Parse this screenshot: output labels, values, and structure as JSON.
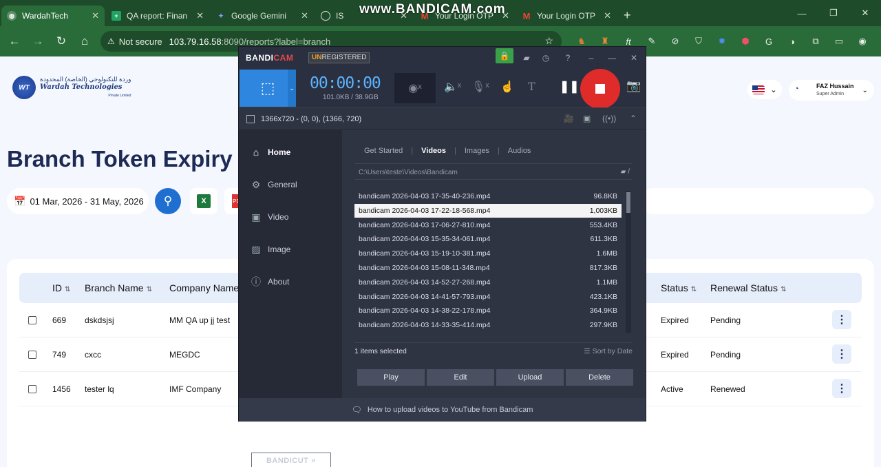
{
  "browser": {
    "tabs": [
      {
        "title": "WardahTech",
        "icon": "globe-icon",
        "active": true
      },
      {
        "title": "QA report: Finan",
        "icon": "sheets-icon",
        "active": false
      },
      {
        "title": "Google Gemini",
        "icon": "gemini-icon",
        "active": false
      },
      {
        "title": "IS",
        "icon": "chatgpt-icon",
        "active": false
      },
      {
        "title": "Your Login OTP",
        "icon": "gmail-icon",
        "active": false
      },
      {
        "title": "Your Login OTP",
        "icon": "gmail-icon",
        "active": false
      }
    ],
    "new_tab": "+",
    "security_label": "Not secure",
    "url_host": "103.79.16.58",
    "url_rest": ":8090/reports?label=branch"
  },
  "watermark": "www.BANDICAM.com",
  "app": {
    "logo_arabic": "وردة للتكنولوجي (الخاصة) المحدودة",
    "logo_name": "Wardah Technologies",
    "logo_tag": "Private Limited",
    "logo_mark": "WT",
    "user_name": "FAZ Hussain",
    "user_role": "Super Admin",
    "page_title": "Branch Token Expiry",
    "date_range": "01 Mar, 2026 - 31 May, 2026",
    "table": {
      "headers": [
        "ID",
        "Branch Name",
        "Company Name",
        "Status",
        "Renewal Status"
      ],
      "rows": [
        {
          "id": "669",
          "branch": "dskdsjsj",
          "company": "MM QA up jj test",
          "status": "Expired",
          "renewal": "Pending"
        },
        {
          "id": "749",
          "branch": "cxcc",
          "company": "MEGDC",
          "status": "Expired",
          "renewal": "Pending"
        },
        {
          "id": "1456",
          "branch": "tester lq",
          "company": "IMF Company",
          "status": "Active",
          "renewal": "Renewed"
        }
      ]
    }
  },
  "bandicam": {
    "logo_a": "BANDI",
    "logo_b": "CAM",
    "unreg_a": "UN",
    "unreg_b": "REGISTERED",
    "timer": "00:00:00",
    "size": "101.0KB / 38.9GB",
    "area": "1366x720 - (0, 0), (1366, 720)",
    "nav": [
      "Home",
      "General",
      "Video",
      "Image",
      "About"
    ],
    "tabs": [
      "Get Started",
      "Videos",
      "Images",
      "Audios"
    ],
    "path": "C:\\Users\\teste\\Videos\\Bandicam",
    "files": [
      {
        "name": "bandicam 2026-04-03 17-35-40-236.mp4",
        "size": "96.8KB"
      },
      {
        "name": "bandicam 2026-04-03 17-22-18-568.mp4",
        "size": "1,003KB"
      },
      {
        "name": "bandicam 2026-04-03 17-06-27-810.mp4",
        "size": "553.4KB"
      },
      {
        "name": "bandicam 2026-04-03 15-35-34-061.mp4",
        "size": "611.3KB"
      },
      {
        "name": "bandicam 2026-04-03 15-19-10-381.mp4",
        "size": "1.6MB"
      },
      {
        "name": "bandicam 2026-04-03 15-08-11-348.mp4",
        "size": "817.3KB"
      },
      {
        "name": "bandicam 2026-04-03 14-52-27-268.mp4",
        "size": "1.1MB"
      },
      {
        "name": "bandicam 2026-04-03 14-41-57-793.mp4",
        "size": "423.1KB"
      },
      {
        "name": "bandicam 2026-04-03 14-38-22-178.mp4",
        "size": "364.9KB"
      },
      {
        "name": "bandicam 2026-04-03 14-33-35-414.mp4",
        "size": "297.9KB"
      }
    ],
    "selected_index": 1,
    "status": "1 items selected",
    "sort": "Sort by Date",
    "buttons": [
      "Play",
      "Edit",
      "Upload",
      "Delete"
    ],
    "bandicut": "BANDICUT",
    "footer": "How to upload videos to YouTube from Bandicam"
  },
  "colors": {
    "record": "#e02b2b",
    "accent": "#2f86de",
    "page_title": "#1c2a55"
  }
}
